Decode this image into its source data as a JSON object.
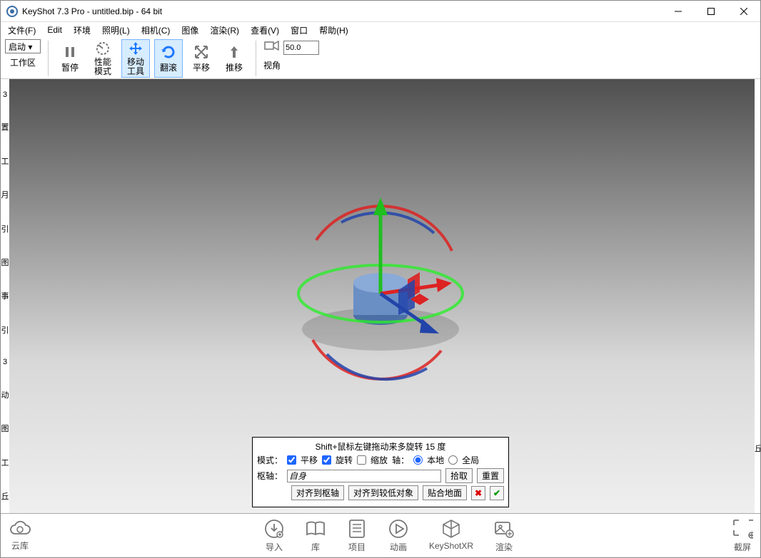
{
  "titlebar": {
    "text": "KeyShot 7.3 Pro  - untitled.bip  - 64 bit"
  },
  "menu": {
    "file": "文件(F)",
    "edit": "Edit",
    "env": "环境",
    "light": "照明(L)",
    "camera": "相机(C)",
    "image": "图像",
    "render": "渲染(R)",
    "view": "查看(V)",
    "window": "窗口",
    "help": "帮助(H)"
  },
  "toolbar": {
    "launch_sel": "启动 ▾",
    "workspace": "工作区",
    "pause": "暂停",
    "perf": "性能\n模式",
    "move": "移动\n工具",
    "tumble": "翻滚",
    "pan": "平移",
    "dolly": "推移",
    "fov_label": "视角",
    "fov_value": "50.0"
  },
  "tpanel": {
    "hint": "Shift+鼠标左键拖动来多旋转 15 度",
    "mode_label": "模式：",
    "chk_pan": "平移",
    "chk_rot": "旋转",
    "chk_scale": "缩放",
    "axis_label": "轴：",
    "radio_local": "本地",
    "radio_global": "全局",
    "pivot_label": "枢轴：",
    "pivot_value": "自身",
    "pick": "拾取",
    "reset": "重置",
    "align_pivot": "对齐到枢轴",
    "align_low": "对齐到较低对象",
    "snap_ground": "贴合地面"
  },
  "bottom": {
    "cloud": "云库",
    "import": "导入",
    "library": "库",
    "project": "项目",
    "anim": "动画",
    "xr": "KeyShotXR",
    "render": "渲染",
    "screenshot": "截屏"
  },
  "leftedge": [
    "3",
    "置",
    "工",
    "月",
    "引",
    "图",
    "事",
    "引",
    "3",
    "动",
    "图",
    "工",
    "丘"
  ],
  "rightedge_char": "丘"
}
